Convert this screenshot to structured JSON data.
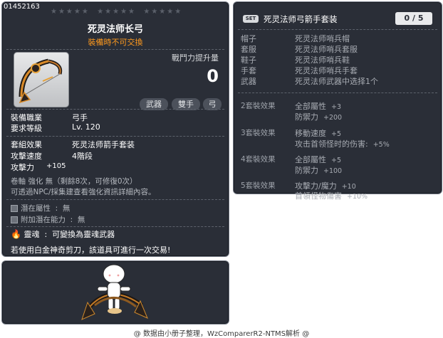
{
  "item": {
    "id_label": "01452163",
    "stars": [
      "★★★★★",
      "★★★★★",
      "★★★★★"
    ],
    "name": "死灵法师长弓",
    "trade_note": "裝備時不可交換",
    "power_title": "戰鬥力提升量",
    "power_value": "0",
    "tags": [
      "武器",
      "雙手",
      "弓"
    ],
    "stats": [
      {
        "label": "裝備職業",
        "value": "弓手"
      },
      {
        "label": "要求等級",
        "value": "Lv. 120"
      }
    ],
    "set_label": "套組效果",
    "set_value": "死灵法师箭手套装",
    "speed_label": "攻擊速度",
    "speed_value": "4階段",
    "attack_label": "攻擊力",
    "attack_value": "+105",
    "scroll_line": "卷軸  強化  無（剩餘8次，可修復0次）",
    "info_line": "可透過NPC/採集建查看強化資訊詳細內容。",
    "potential_label": "潛在屬性",
    "potential_value": "無",
    "additional_label": "附加潛在能力",
    "additional_value": "無",
    "soul_label": "靈魂",
    "soul_value": "可變換為靈魂武器",
    "scissors_note": "若使用白金神奇剪刀，該道具可進行一次交易!"
  },
  "set": {
    "badge": "SET",
    "title": "死灵法师弓箭手套装",
    "count": "0 / 5",
    "parts": [
      {
        "slot": "帽子",
        "name": "死灵法师哨兵帽"
      },
      {
        "slot": "套服",
        "name": "死灵法师哨兵套服"
      },
      {
        "slot": "鞋子",
        "name": "死灵法师哨兵鞋"
      },
      {
        "slot": "手套",
        "name": "死灵法师哨兵手套"
      },
      {
        "slot": "武器",
        "name": "死灵法师武器中选择1个"
      }
    ],
    "effects": [
      {
        "head": "2套裝效果",
        "lines": [
          {
            "text": "全部屬性",
            "num": "+3"
          },
          {
            "text": "防禦力",
            "num": "+200"
          }
        ]
      },
      {
        "head": "3套裝效果",
        "lines": [
          {
            "text": "移動速度",
            "num": "+5"
          },
          {
            "text": "攻击首领怪时的伤害:",
            "num": "+5%"
          }
        ]
      },
      {
        "head": "4套裝效果",
        "lines": [
          {
            "text": "全部屬性",
            "num": "+5"
          },
          {
            "text": "防禦力",
            "num": "+100"
          }
        ]
      },
      {
        "head": "5套裝效果",
        "lines": [
          {
            "text": "攻擊力/魔力",
            "num": "+10"
          },
          {
            "text": "首領怪物傷害",
            "num": "+10%"
          }
        ]
      }
    ]
  },
  "footer": "@ 数据由小册子整理，WzComparerR2-NTMS解析 @",
  "icons": {
    "bow": "bow-icon",
    "soul": "flame-icon",
    "potential": "potential-box-icon",
    "character": "character-preview"
  },
  "colors": {
    "panel_bg": "#2a2e37",
    "trade_note": "#ff9a1e",
    "dim_text": "#a7abb2"
  }
}
